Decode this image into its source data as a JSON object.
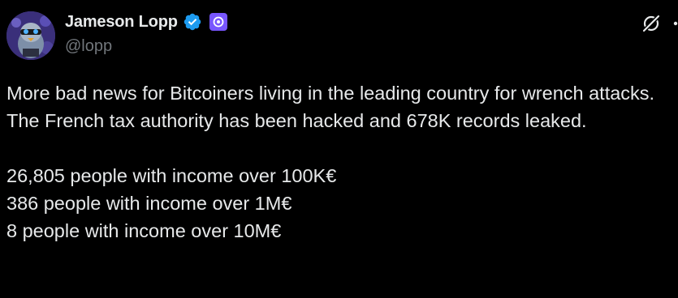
{
  "author": {
    "display_name": "Jameson Lopp",
    "handle": "@lopp",
    "verified_icon": "verified-check-icon",
    "affiliate_icon": "affiliate-badge-icon",
    "avatar_icon": "avatar-cartoon-bird-icon"
  },
  "actions": {
    "grok_icon": "grok-slash-icon",
    "more_icon": "more-options-icon"
  },
  "tweet": {
    "paragraph1": "More bad news for Bitcoiners living in the leading country for wrench attacks. The French tax authority has been hacked and 678K records leaked.",
    "lines": [
      "26,805 people with income over 100K€",
      "386 people with income over 1M€",
      "8 people with income over 10M€"
    ]
  },
  "colors": {
    "background": "#000000",
    "text_primary": "#e7e9ea",
    "text_secondary": "#71767b",
    "verified_blue": "#1d9bf0",
    "affiliate_purple": "#7856ff"
  }
}
